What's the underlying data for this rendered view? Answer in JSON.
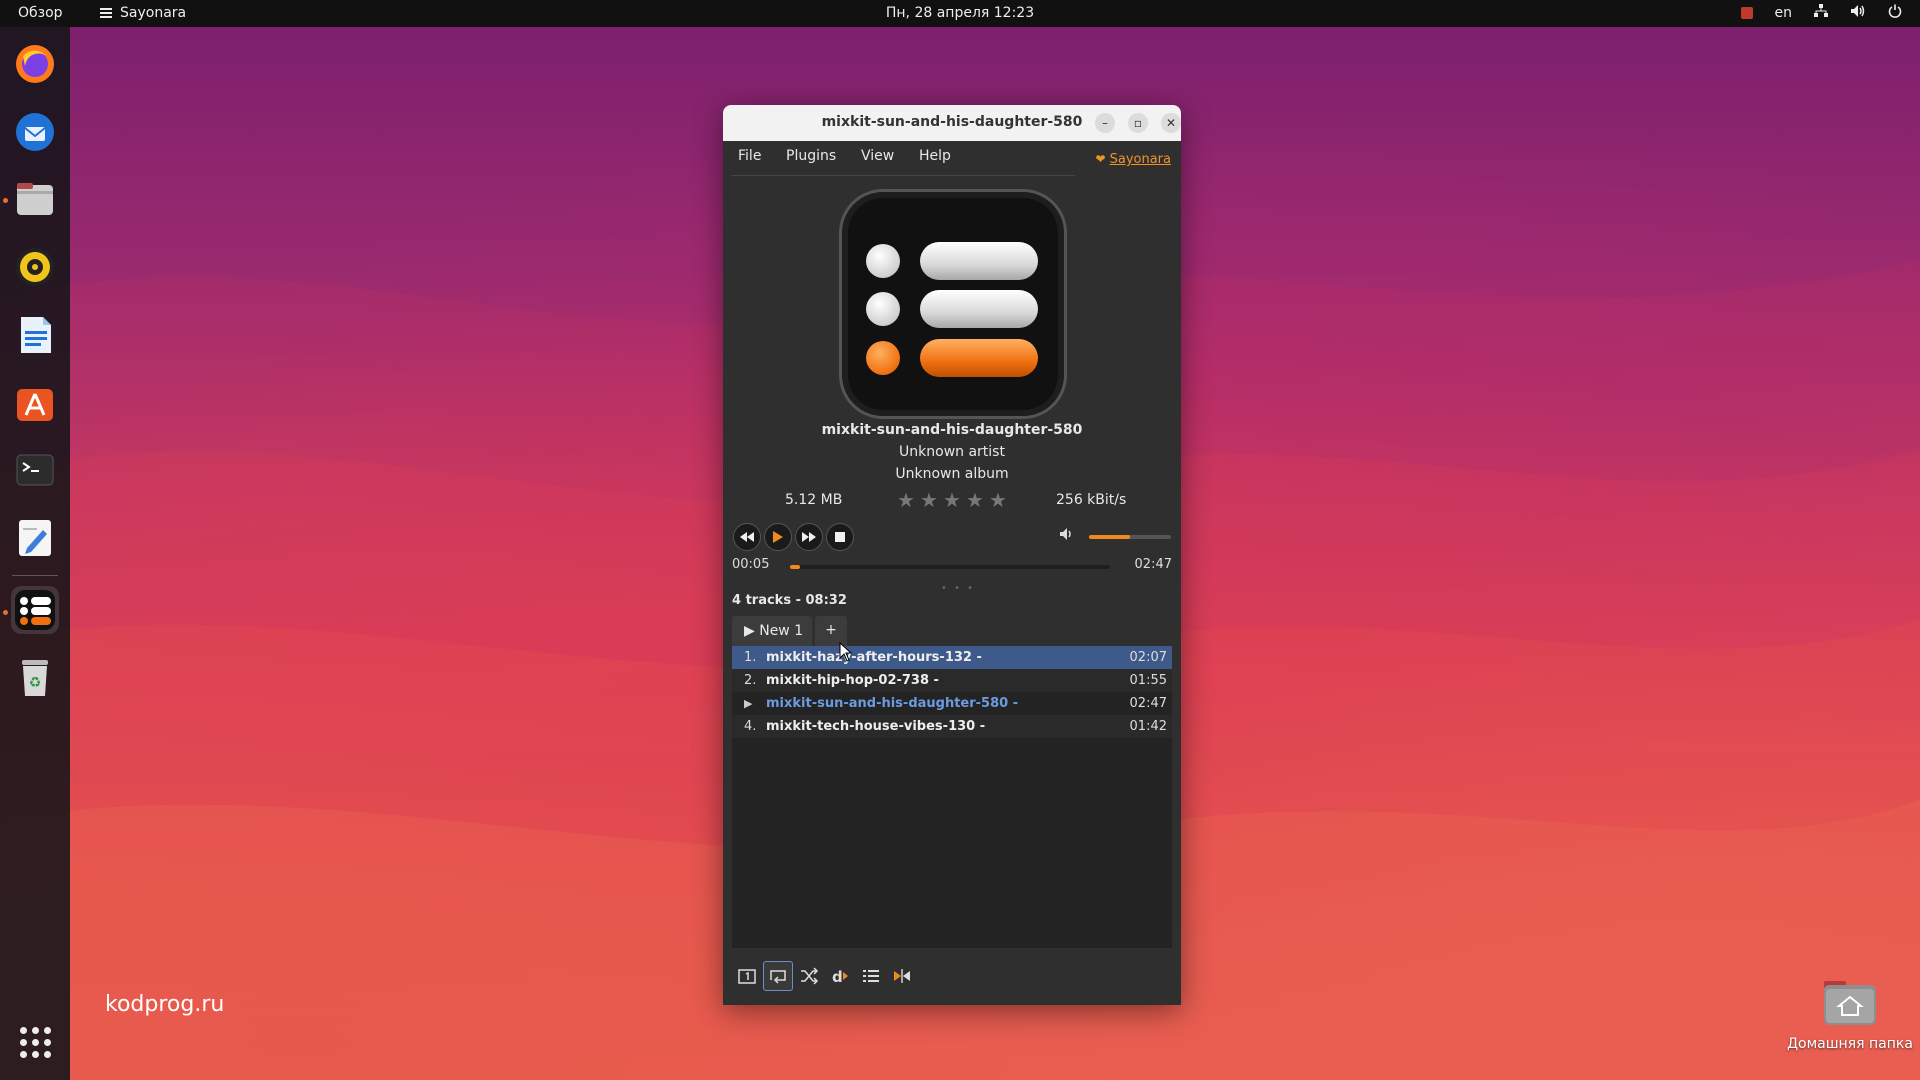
{
  "topbar": {
    "activities": "Обзор",
    "app_name": "Sayonara",
    "clock": "Пн, 28 апреля  12:23",
    "keyboard_layout": "en"
  },
  "dock": {
    "items": [
      {
        "name": "firefox",
        "icon": "firefox-icon"
      },
      {
        "name": "thunderbird",
        "icon": "thunderbird-icon"
      },
      {
        "name": "files",
        "icon": "files-icon"
      },
      {
        "name": "rhythmbox",
        "icon": "rhythmbox-icon"
      },
      {
        "name": "libreoffice-writer",
        "icon": "writer-icon"
      },
      {
        "name": "app-center",
        "icon": "app-center-icon"
      },
      {
        "name": "terminal",
        "icon": "terminal-icon"
      },
      {
        "name": "text-editor",
        "icon": "text-editor-icon"
      },
      {
        "name": "sayonara",
        "icon": "sayonara-icon"
      },
      {
        "name": "trash",
        "icon": "trash-icon"
      },
      {
        "name": "show-apps",
        "icon": "grid-icon"
      }
    ]
  },
  "desktop": {
    "watermark": "kodprog.ru",
    "home_folder_label": "Домашняя папка"
  },
  "window": {
    "title": "mixkit-sun-and-his-daughter-580",
    "menu": [
      "File",
      "Plugins",
      "View",
      "Help"
    ],
    "sayonara_link": "Sayonara",
    "track": {
      "title": "mixkit-sun-and-his-daughter-580",
      "artist": "Unknown artist",
      "album": "Unknown album",
      "filesize": "5.12 MB",
      "bitrate": "256 kBit/s",
      "rating": 0,
      "rating_max": 5
    },
    "playback": {
      "current_time": "00:05",
      "total_time": "02:47",
      "progress_fraction": 0.03,
      "volume_fraction": 0.5
    },
    "playlist_summary": "4 tracks - 08:32",
    "playlist_tab": "▶ New 1",
    "playlist_add": "+",
    "tracks": [
      {
        "num": "1.",
        "name": "mixkit-hazy-after-hours-132 -",
        "duration": "02:07",
        "selected": true,
        "playing": false
      },
      {
        "num": "2.",
        "name": "mixkit-hip-hop-02-738 -",
        "duration": "01:55",
        "selected": false,
        "playing": false
      },
      {
        "num": "▶",
        "name": "mixkit-sun-and-his-daughter-580 -",
        "duration": "02:47",
        "selected": false,
        "playing": true
      },
      {
        "num": "4.",
        "name": "mixkit-tech-house-vibes-130 -",
        "duration": "01:42",
        "selected": false,
        "playing": false
      }
    ],
    "accent_color": "#f08a1e",
    "selection_color": "#3e5a8a",
    "playing_text_color": "#6c9be0"
  }
}
